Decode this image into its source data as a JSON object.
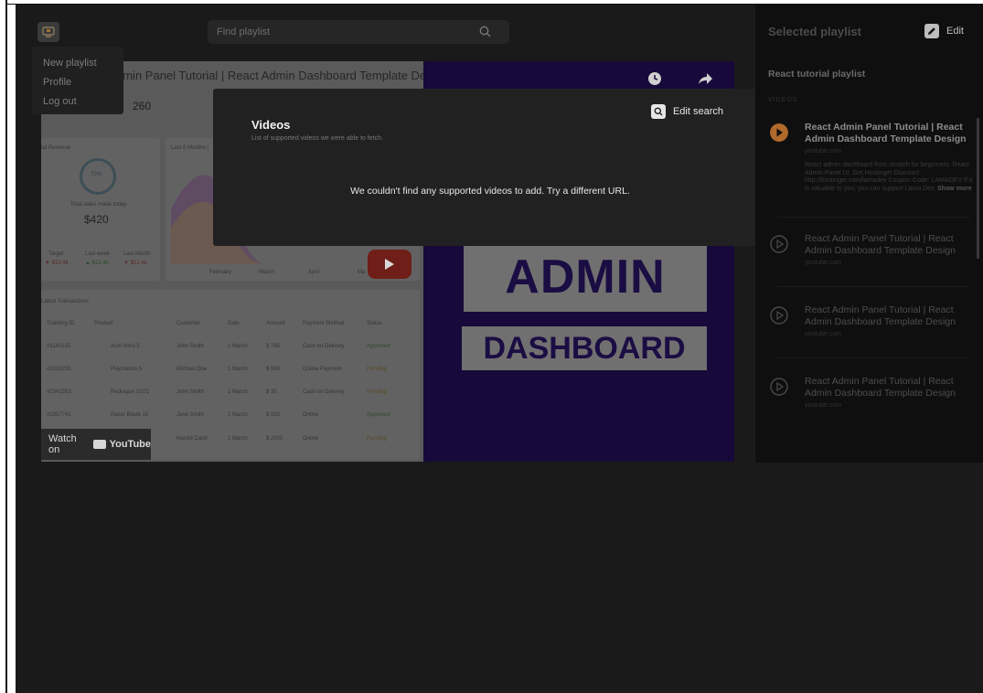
{
  "header": {
    "search_placeholder": "Find playlist"
  },
  "menu": {
    "items": [
      "New playlist",
      "Profile",
      "Log out"
    ]
  },
  "video_thumb": {
    "title_partial": "dmin Panel Tutorial | React Admin Dashboard Template Design",
    "stat_value": "260",
    "revenue_percent": "70%",
    "revenue_amount": "$420",
    "total_sales_label": "Total sales made today",
    "latest_transactions": "Latest Transactions",
    "last_months": "Last 6 Months (",
    "total_revenue": "tal Revenue",
    "months": [
      "February",
      "March",
      "April",
      "Ma"
    ],
    "table_headers": [
      "Tracking ID",
      "Product",
      "Customer",
      "Date",
      "Amount",
      "Payment Method",
      "Status"
    ],
    "table_rows": [
      [
        "#1143155",
        "Acer Nitro 5",
        "John Smith",
        "1 March",
        "$ 785",
        "Cash on Delivery",
        "Approved"
      ],
      [
        "#2235235",
        "Playstation 5",
        "Michael Doe",
        "1 March",
        "$ 900",
        "Online Payment",
        "Pending"
      ],
      [
        "#2342353",
        "Redragon S101",
        "John Smith",
        "1 March",
        "$ 35",
        "Cash on Delivery",
        "Pending"
      ],
      [
        "#2357741",
        "Razer Blade 15",
        "Jane Smith",
        "1 March",
        "$ 920",
        "Online",
        "Approved"
      ],
      [
        "",
        "",
        "Harold Carol",
        "1 March",
        "$ 2000",
        "Online",
        "Pending"
      ]
    ],
    "target_labels": [
      "Target",
      "Last week",
      "Last Month"
    ],
    "target_values": [
      "▼ $12.4k",
      "▲ $12.4k",
      "▼ $12.4k"
    ],
    "watch_on": "Watch on",
    "youtube": "YouTube",
    "admin_word": "ADMIN",
    "dashboard_word": "DASHBOARD"
  },
  "modal": {
    "title": "Videos",
    "subtitle": "List of supported videos we were able to fetch.",
    "edit_search": "Edit search",
    "message": "We couldn't find any supported videos to add. Try a different URL."
  },
  "panel": {
    "title": "Selected playlist",
    "edit_label": "Edit",
    "playlist_name": "React tutorial playlist",
    "videos_label": "VIDEOS",
    "items": [
      {
        "title": "React Admin Panel Tutorial | React Admin Dashboard Template Design",
        "source": "youtube.com",
        "description": "React admin dashboard from scratch for beginners. React Admin Panel UI. Get Hostinger Discount: http://hostinger.com/lamadev Coupon Code: LAMADEV If it is valuable to you, you can support Lama Dev.",
        "show_more": "Show more"
      },
      {
        "title": "React Admin Panel Tutorial | React Admin Dashboard Template Design",
        "source": "youtube.com"
      },
      {
        "title": "React Admin Panel Tutorial | React Admin Dashboard Template Design",
        "source": "youtube.com"
      },
      {
        "title": "React Admin Panel Tutorial | React Admin Dashboard Template Design",
        "source": "youtube.com"
      }
    ]
  },
  "colors": {
    "app_bg": "#1a1a1b",
    "panel_bg": "#0f0f10",
    "modal_bg": "#212122",
    "active_play": "#b06a2c"
  }
}
